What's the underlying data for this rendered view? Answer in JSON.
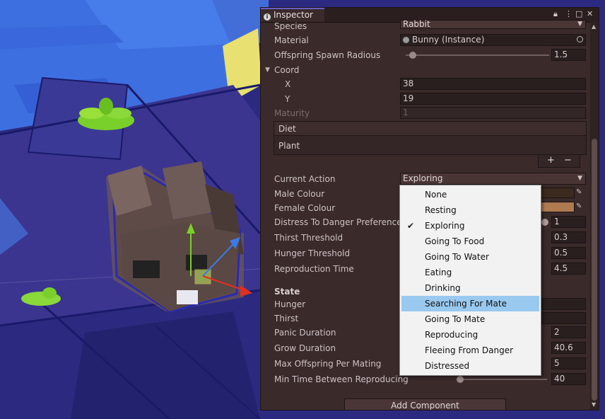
{
  "inspector": {
    "tab_title": "Inspector",
    "species": {
      "label": "Species",
      "value": "Rabbit"
    },
    "material": {
      "label": "Material",
      "value": "Bunny (Instance)"
    },
    "offspring_radius": {
      "label": "Offspring Spawn Radious",
      "value": "1.5",
      "fraction": 0.05
    },
    "coord": {
      "label": "Coord",
      "x_label": "X",
      "x_value": "38",
      "y_label": "Y",
      "y_value": "19"
    },
    "maturity": {
      "label": "Maturity",
      "value": "1"
    },
    "diet": {
      "header": "Diet",
      "item": "Plant",
      "add": "+",
      "remove": "−"
    },
    "current_action": {
      "label": "Current Action",
      "value": "Exploring"
    },
    "male_colour": {
      "label": "Male Colour",
      "color": "#3d2a1e"
    },
    "female_colour": {
      "label": "Female Colour",
      "color": "#b07a50"
    },
    "distress_pref": {
      "label": "Distress To Danger Preference",
      "value": "1"
    },
    "thirst_threshold": {
      "label": "Thirst Threshold",
      "value": "0.3"
    },
    "hunger_threshold": {
      "label": "Hunger Threshold",
      "value": "0.5"
    },
    "reproduction_time": {
      "label": "Reproduction Time",
      "value": "4.5"
    },
    "state_header": "State",
    "hunger": {
      "label": "Hunger"
    },
    "thirst": {
      "label": "Thirst"
    },
    "panic_duration": {
      "label": "Panic Duration",
      "value": "2"
    },
    "grow_duration": {
      "label": "Grow Duration",
      "value": "40.6"
    },
    "max_offspring": {
      "label": "Max Offspring Per Mating",
      "value": "5"
    },
    "min_time_repro": {
      "label": "Min Time Between Reproducing",
      "value": "40"
    },
    "add_component": "Add Component"
  },
  "action_menu": {
    "checked_index": 2,
    "highlighted_index": 7,
    "items": [
      "None",
      "Resting",
      "Exploring",
      "Going To Food",
      "Going To Water",
      "Eating",
      "Drinking",
      "Searching For Mate",
      "Going To Mate",
      "Reproducing",
      "Fleeing From Danger",
      "Distressed"
    ]
  },
  "colors": {
    "panel_bg": "#3a2a2a",
    "accent": "#6b5cc8",
    "menu_highlight": "#99c9ef"
  }
}
